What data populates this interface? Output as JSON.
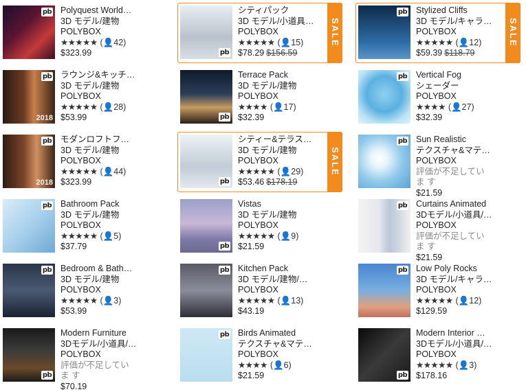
{
  "items": [
    {
      "name": "Polyquest World…",
      "category": "3D モデル/建物",
      "publisher": "POLYBOX",
      "stars": "★★★★★",
      "reviews": "(👤42)",
      "price": "$323.99",
      "sale": false
    },
    {
      "name": "シティパック",
      "category": "3D モデル/小道具/…",
      "publisher": "POLYBOX",
      "stars": "★★★★★",
      "reviews": "(👤15)",
      "price": "$78.29",
      "old_price": "$156.59",
      "sale": true,
      "sale_label": "SALE"
    },
    {
      "name": "Stylized Cliffs",
      "category": "3D モデル/キャラ…",
      "publisher": "POLYBOX",
      "stars": "★★★★★",
      "reviews": "(👤12)",
      "price": "$59.39",
      "old_price": "$118.79",
      "sale": true,
      "sale_label": "SALE"
    },
    {
      "name": "ラウンジ&キッチ…",
      "category": "3D モデル/建物",
      "publisher": "POLYBOX",
      "stars": "★★★★★",
      "reviews": "(👤28)",
      "price": "$53.99",
      "year": "2018",
      "sale": false
    },
    {
      "name": "Terrace Pack",
      "category": "3D モデル/建物",
      "publisher": "POLYBOX",
      "stars": "★★★★",
      "reviews": "(👤17)",
      "price": "$32.39",
      "sale": false
    },
    {
      "name": "Vertical Fog",
      "category": "シェーダー",
      "publisher": "POLYBOX",
      "stars": "★★★★",
      "reviews": "(👤27)",
      "price": "$32.39",
      "sale": false
    },
    {
      "name": "モダンロフトフル…",
      "category": "3D モデル/建物",
      "publisher": "POLYBOX",
      "stars": "★★★★★",
      "reviews": "(👤44)",
      "price": "$323.99",
      "year": "2018",
      "sale": false
    },
    {
      "name": "シティー&テラス…",
      "category": "3D モデル/建物",
      "publisher": "POLYBOX",
      "stars": "★★★★★",
      "reviews": "(👤29)",
      "price": "$53.46",
      "old_price": "$178.19",
      "sale": true,
      "sale_label": "SALE"
    },
    {
      "name": "Sun Realistic",
      "category": "テクスチャ&マテ…",
      "publisher": "POLYBOX",
      "note": "評価が不足していま す",
      "price": "$21.59",
      "sale": false
    },
    {
      "name": "Bathroom Pack",
      "category": "3D モデル/建物",
      "publisher": "POLYBOX",
      "stars": "★★★★★",
      "reviews": "(👤5)",
      "price": "$37.79",
      "sale": false
    },
    {
      "name": "Vistas",
      "category": "3D モデル/建物",
      "publisher": "POLYBOX",
      "stars": "★★★★★",
      "reviews": "(👤9)",
      "price": "$21.59",
      "sale": false
    },
    {
      "name": "Curtains Animated",
      "category": "3Dモデル/小道具/…",
      "publisher": "POLYBOX",
      "note": "評価が不足していま す",
      "price": "$21.59",
      "sale": false
    },
    {
      "name": "Bedroom & Bath…",
      "category": "3D モデル/建物",
      "publisher": "POLYBOX",
      "stars": "★★★★★",
      "reviews": "(👤3)",
      "price": "$53.99",
      "sale": false
    },
    {
      "name": "Kitchen Pack",
      "category": "3D モデル/建物/…",
      "publisher": "POLYBOX",
      "stars": "★★★★★",
      "reviews": "(👤13)",
      "price": "$43.19",
      "sale": false
    },
    {
      "name": "Low Poly Rocks",
      "category": "3D モデル/キャラ…",
      "publisher": "POLYBOX",
      "stars": "★★★★★",
      "reviews": "(👤12)",
      "price": "$129.59",
      "sale": false
    },
    {
      "name": "Modern Furniture",
      "category": "3Dモデル/小道具/…",
      "publisher": "POLYBOX",
      "note": "評価が不足していま す",
      "price": "$70.19",
      "sale": false
    },
    {
      "name": "Birds Animated",
      "category": "テクスチャ&マテ…",
      "publisher": "POLYBOX",
      "stars": "★★★★",
      "reviews": "(👤6)",
      "price": "$21.59",
      "sale": false
    },
    {
      "name": "Modern Interior …",
      "category": "3Dモデル/小道具/…",
      "publisher": "POLYBOX",
      "stars": "★★★★★",
      "reviews": "(👤3)",
      "price": "$178.16",
      "sale": false
    }
  ],
  "logo_text": "pb",
  "colors": {
    "sale": "#f28a1d"
  }
}
